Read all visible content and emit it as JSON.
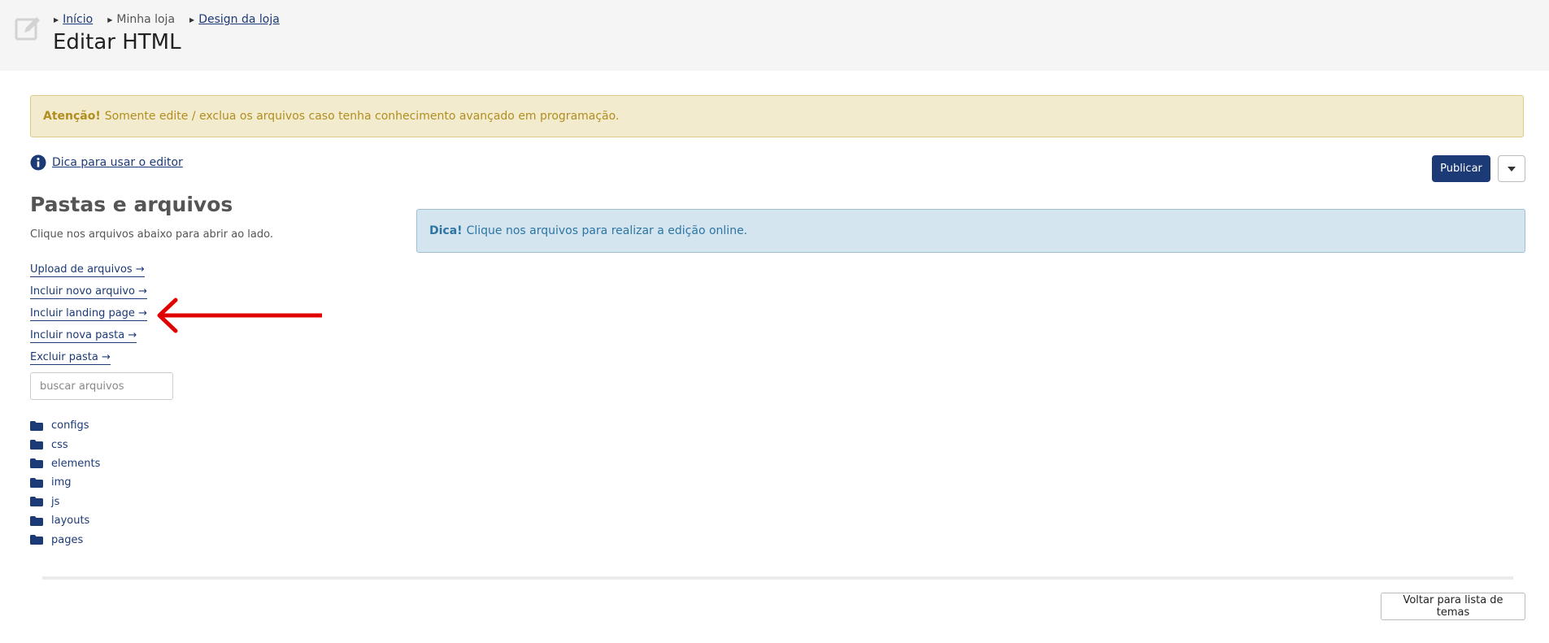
{
  "breadcrumb": [
    {
      "label": "Início",
      "link": true
    },
    {
      "label": "Minha loja",
      "link": false
    },
    {
      "label": "Design da loja",
      "link": true
    }
  ],
  "page_title": "Editar HTML",
  "warning": {
    "strong": "Atenção!",
    "text": "Somente edite / exclua os arquivos caso tenha conhecimento avançado em programação."
  },
  "tip_link": "Dica para usar o editor",
  "publish_label": "Publicar",
  "sidebar": {
    "title": "Pastas e arquivos",
    "subtitle": "Clique nos arquivos abaixo para abrir ao lado.",
    "actions": [
      "Upload de arquivos",
      "Incluir novo arquivo",
      "Incluir landing page",
      "Incluir nova pasta",
      "Excluir pasta"
    ],
    "search_placeholder": "buscar arquivos",
    "folders": [
      "configs",
      "css",
      "elements",
      "img",
      "js",
      "layouts",
      "pages"
    ]
  },
  "info": {
    "strong": "Dica!",
    "text": "Clique nos arquivos para realizar a edição online."
  },
  "back_label": "Voltar para lista de temas",
  "colors": {
    "primary": "#1c3a75",
    "warning_bg": "#f3ebce",
    "info_bg": "#d4e5ef",
    "annotation_arrow": "#e00000"
  },
  "icons": {
    "header": "edit-icon",
    "tip": "info-icon",
    "folder": "folder-icon",
    "link_arrow": "arrow-right-icon",
    "dropdown": "caret-down-icon"
  }
}
